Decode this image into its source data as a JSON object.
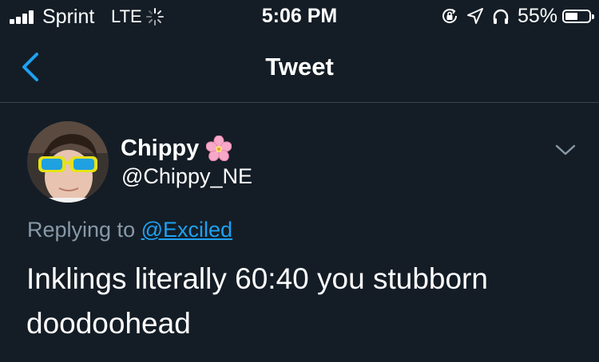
{
  "status_bar": {
    "carrier": "Sprint",
    "network": "LTE",
    "time": "5:06 PM",
    "battery_percent": "55%",
    "battery_level": 0.55,
    "icons": [
      "signal-bars-icon",
      "loading-spinner-icon",
      "orientation-lock-icon",
      "location-arrow-icon",
      "headphones-icon",
      "battery-icon"
    ]
  },
  "nav": {
    "title": "Tweet",
    "back_icon": "chevron-left-icon"
  },
  "tweet": {
    "display_name": "Chippy",
    "name_emoji_icon": "cherry-blossom-icon",
    "handle": "@Chippy_NE",
    "replying_prefix": "Replying to",
    "replying_to": "@Exciled",
    "text": "Inklings literally 60:40 you stubborn doodoohead",
    "menu_icon": "chevron-down-icon"
  },
  "colors": {
    "background": "#141d26",
    "divider": "#38444d",
    "accent": "#1da1f2",
    "secondary_text": "#8899a6"
  }
}
